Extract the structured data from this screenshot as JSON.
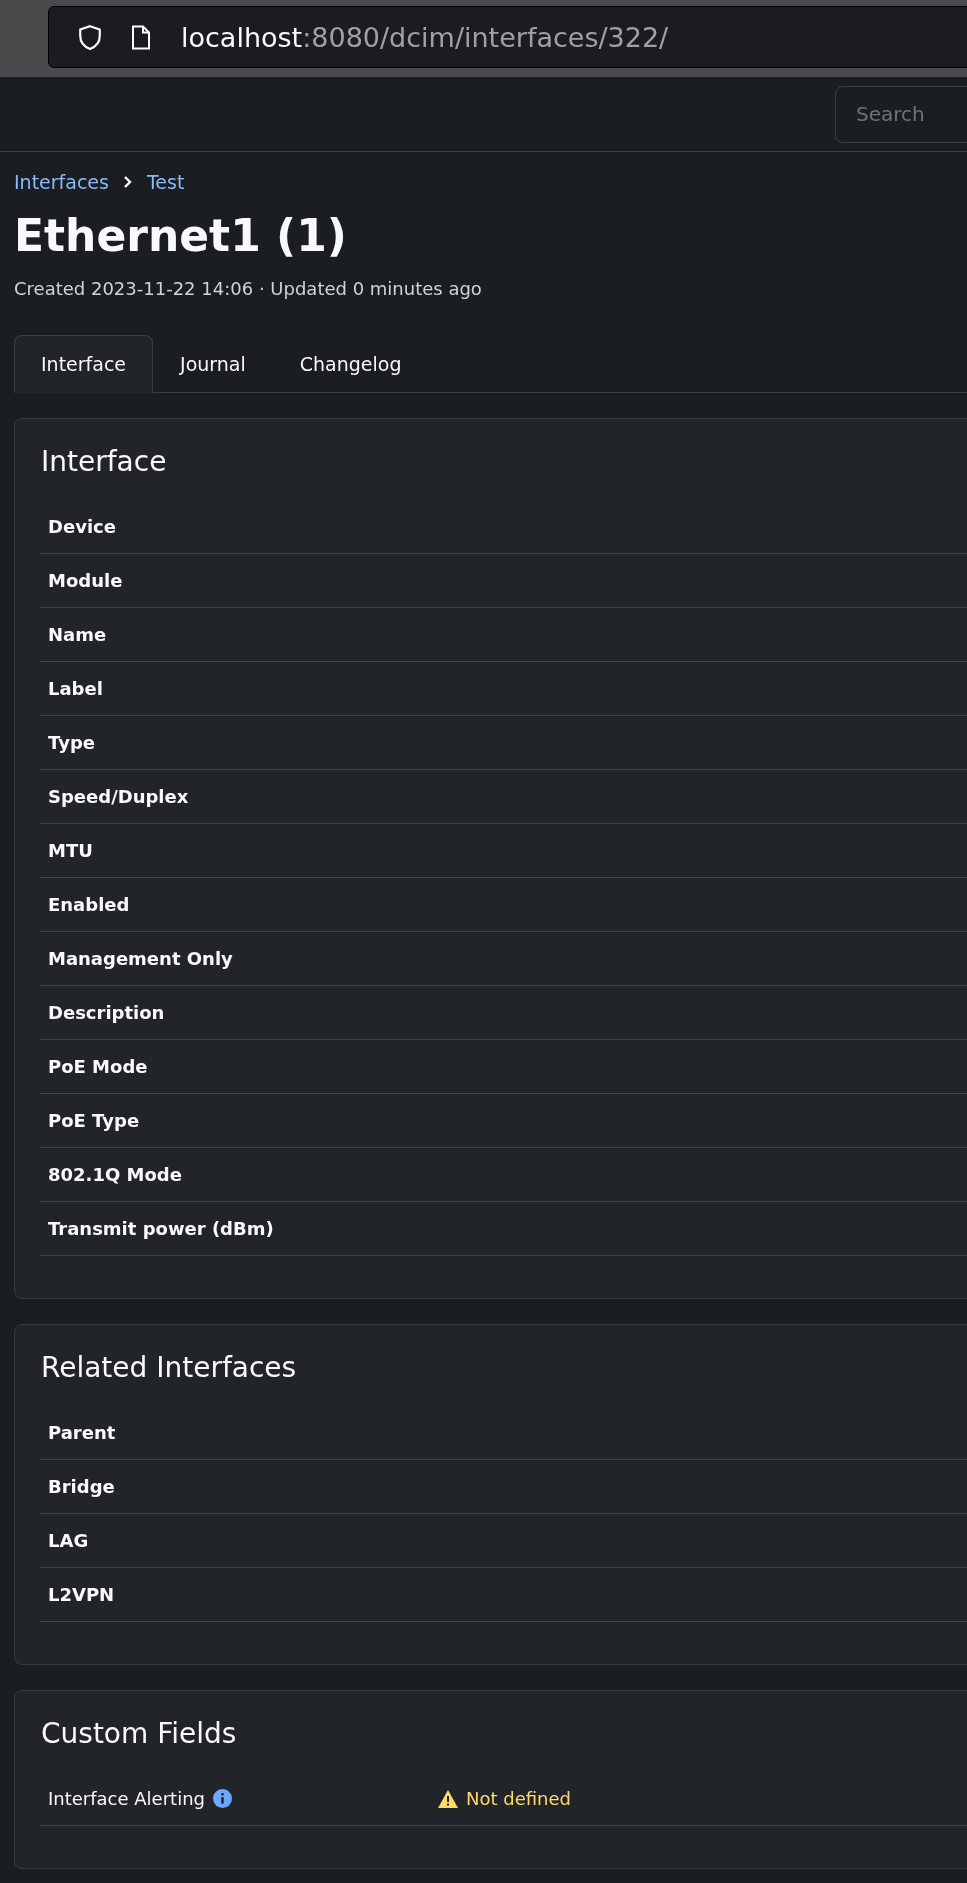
{
  "browser": {
    "url_host": "localhost",
    "url_rest": ":8080/dcim/interfaces/322/"
  },
  "search": {
    "placeholder": "Search"
  },
  "breadcrumbs": [
    "Interfaces",
    "Test"
  ],
  "title": "Ethernet1 (1)",
  "subtitle": "Created 2023-11-22 14:06 · Updated 0 minutes ago",
  "tabs": [
    {
      "label": "Interface",
      "selected": true
    },
    {
      "label": "Journal",
      "selected": false
    },
    {
      "label": "Changelog",
      "selected": false
    }
  ],
  "cards": [
    {
      "title": "Interface",
      "kind": "attributes",
      "rows": [
        {
          "label": "Device"
        },
        {
          "label": "Module"
        },
        {
          "label": "Name"
        },
        {
          "label": "Label"
        },
        {
          "label": "Type"
        },
        {
          "label": "Speed/Duplex"
        },
        {
          "label": "MTU"
        },
        {
          "label": "Enabled"
        },
        {
          "label": "Management Only"
        },
        {
          "label": "Description"
        },
        {
          "label": "PoE Mode"
        },
        {
          "label": "PoE Type"
        },
        {
          "label": "802.1Q Mode"
        },
        {
          "label": "Transmit power (dBm)"
        }
      ]
    },
    {
      "title": "Related Interfaces",
      "kind": "attributes",
      "rows": [
        {
          "label": "Parent"
        },
        {
          "label": "Bridge"
        },
        {
          "label": "LAG"
        },
        {
          "label": "L2VPN"
        }
      ]
    },
    {
      "title": "Custom Fields",
      "kind": "custom",
      "rows": [
        {
          "label": "Interface Alerting",
          "value": "Not defined"
        }
      ]
    }
  ]
}
